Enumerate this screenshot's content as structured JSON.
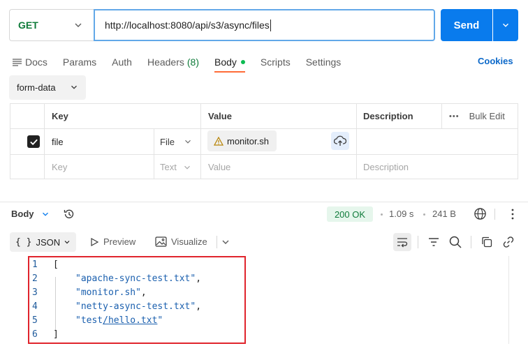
{
  "request": {
    "method": "GET",
    "url": "http://localhost:8080/api/s3/async/files",
    "send_label": "Send"
  },
  "tabs": [
    {
      "label": "Docs"
    },
    {
      "label": "Params"
    },
    {
      "label": "Auth"
    },
    {
      "label": "Headers",
      "count": "(8)"
    },
    {
      "label": "Body",
      "active": true
    },
    {
      "label": "Scripts"
    },
    {
      "label": "Settings"
    }
  ],
  "cookies_label": "Cookies",
  "body_type": "form-data",
  "table": {
    "headers": {
      "key": "Key",
      "value": "Value",
      "description": "Description",
      "bulk_edit": "Bulk Edit"
    },
    "rows": [
      {
        "checked": true,
        "key": "file",
        "type": "File",
        "value": "monitor.sh",
        "description": ""
      }
    ],
    "placeholder": {
      "key": "Key",
      "type": "Text",
      "value": "Value",
      "description": "Description"
    }
  },
  "response": {
    "section_label": "Body",
    "status": "200 OK",
    "time": "1.09 s",
    "size": "241 B",
    "format": "JSON",
    "preview_label": "Preview",
    "visualize_label": "Visualize"
  },
  "code": {
    "line_numbers": [
      "1",
      "2",
      "3",
      "4",
      "5",
      "6"
    ],
    "open": "[",
    "items": [
      "\"apache-sync-test.txt\"",
      "\"monitor.sh\"",
      "\"netty-async-test.txt\""
    ],
    "last_prefix": "\"test",
    "last_link": "/hello.txt",
    "last_suffix": "\"",
    "comma": ",",
    "close": "]"
  },
  "colors": {
    "accent": "#097bed",
    "method": "#0f7b3a",
    "active_tab": "#ff6c37",
    "highlight_box": "#e0242c",
    "json_string": "#1a5fae"
  }
}
